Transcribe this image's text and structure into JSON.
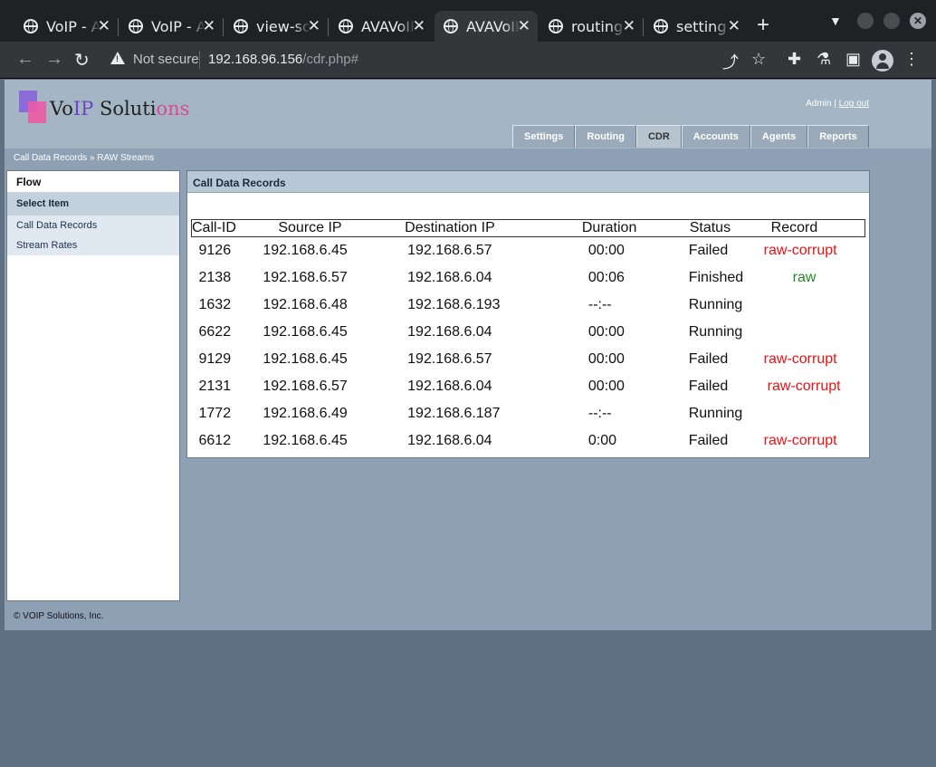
{
  "browser": {
    "tabs": [
      {
        "title": "VoIP - A",
        "active": false
      },
      {
        "title": "VoIP - A",
        "active": false
      },
      {
        "title": "view-so",
        "active": false
      },
      {
        "title": "AVAVoIP",
        "active": false
      },
      {
        "title": "AVAVoIP",
        "active": true
      },
      {
        "title": "routing",
        "active": false
      },
      {
        "title": "setting",
        "active": false
      }
    ],
    "security": "Not secure",
    "url_host": "192.168.96.156",
    "url_path": "/cdr.php#"
  },
  "header": {
    "logo": {
      "part1": "Vo",
      "part2": "IP",
      "part3": " Soluti",
      "part4": "ons"
    },
    "user": "Admin",
    "user_sep": "|",
    "logout": "Log out",
    "menu": [
      "Settings",
      "Routing",
      "CDR",
      "Accounts",
      "Agents",
      "Reports"
    ],
    "active_menu": "CDR"
  },
  "breadcrumb": {
    "item1": "Call Data Records",
    "sep": "»",
    "item2": "RAW Streams"
  },
  "sidebar": {
    "flow": "Flow",
    "select": "Select Item",
    "items": [
      "Call Data Records",
      "Stream Rates"
    ]
  },
  "panel": {
    "title": "Call Data Records",
    "columns": [
      "Call-ID",
      "Source IP",
      "Destination IP",
      "Duration",
      "Status",
      "Record"
    ],
    "rows": [
      {
        "id": "9126",
        "src": "192.168.6.45",
        "dst": "192.168.6.57",
        "dur": "00:00",
        "status": "Failed",
        "record": "raw-corrupt"
      },
      {
        "id": "2138",
        "src": "192.168.6.57",
        "dst": "192.168.6.04",
        "dur": "00:06",
        "status": "Finished",
        "record": "raw"
      },
      {
        "id": "1632",
        "src": "192.168.6.48",
        "dst": "192.168.6.193",
        "dur": "--:--",
        "status": "Running",
        "record": ""
      },
      {
        "id": "6622",
        "src": "192.168.6.45",
        "dst": "192.168.6.04",
        "dur": "00:00",
        "status": "Running",
        "record": ""
      },
      {
        "id": "9129",
        "src": "192.168.6.45",
        "dst": "192.168.6.57",
        "dur": "00:00",
        "status": "Failed",
        "record": "raw-corrupt"
      },
      {
        "id": "2131",
        "src": "192.168.6.57",
        "dst": "192.168.6.04",
        "dur": "00:00",
        "status": "Failed",
        "record": "raw-corrupt"
      },
      {
        "id": "1772",
        "src": "192.168.6.49",
        "dst": "192.168.6.187",
        "dur": "--:--",
        "status": "Running",
        "record": ""
      },
      {
        "id": "6612",
        "src": "192.168.6.45",
        "dst": "192.168.6.04",
        "dur": "0:00",
        "status": "Failed",
        "record": "raw-corrupt"
      }
    ]
  },
  "footer": "© VOIP Solutions, Inc.",
  "colors": {
    "record_bad": "#ee1111",
    "record_ok": "#228822",
    "page_bg": "#8ea1b4"
  }
}
